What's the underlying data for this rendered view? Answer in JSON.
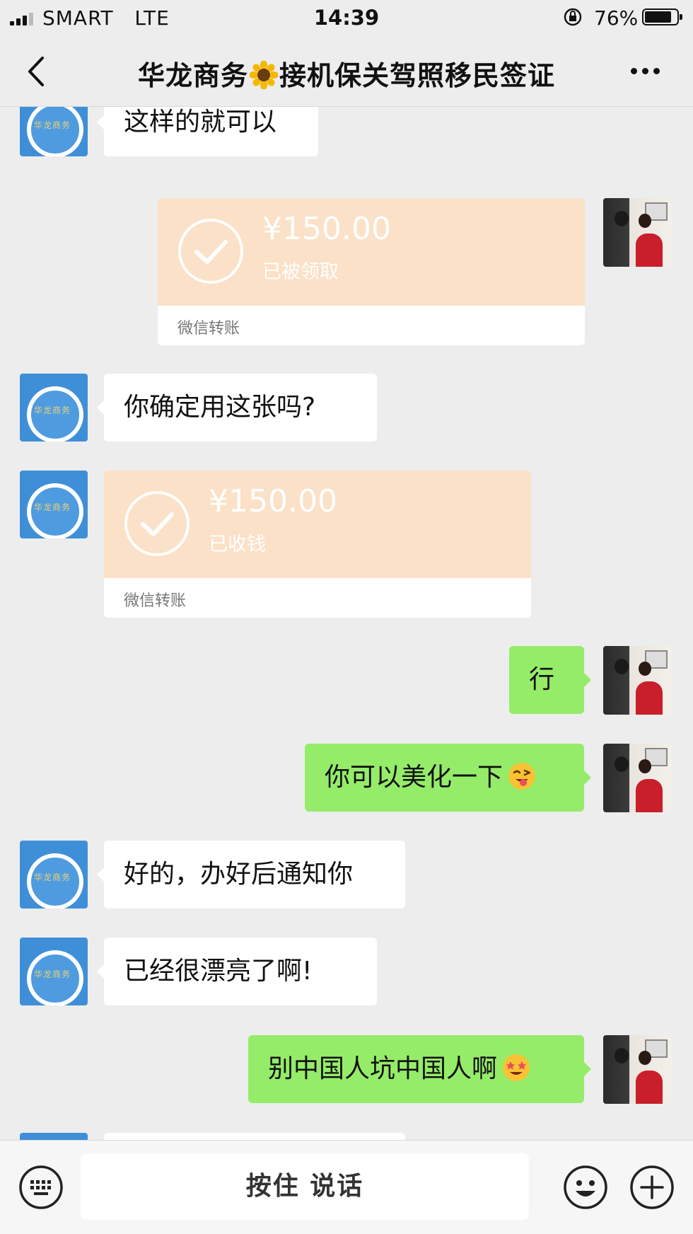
{
  "status_bar": {
    "carrier": "SMART",
    "network": "LTE",
    "time": "14:39",
    "battery": "76%",
    "battery_level": 0.76
  },
  "nav": {
    "title_part1": "华龙商务",
    "title_part2": "接机保关驾照移民签证"
  },
  "messages": {
    "m1": "这样的就可以",
    "transfer1": {
      "amount": "¥150.00",
      "status": "已被领取",
      "label": "微信转账"
    },
    "m2": "你确定用这张吗?",
    "transfer2": {
      "amount": "¥150.00",
      "status": "已收钱",
      "label": "微信转账"
    },
    "m3": "行",
    "m4": "你可以美化一下",
    "m5": "好的，办好后通知你",
    "m6": "已经很漂亮了啊!",
    "m7": "别中国人坑中国人啊"
  },
  "contact_avatar_text": "华龙商务",
  "input": {
    "hold_to_talk": "按住 说话"
  },
  "colors": {
    "background": "#ededed",
    "outgoing_bubble": "#95ec69",
    "incoming_bubble": "#ffffff",
    "transfer_card": "#fbe1c7"
  }
}
